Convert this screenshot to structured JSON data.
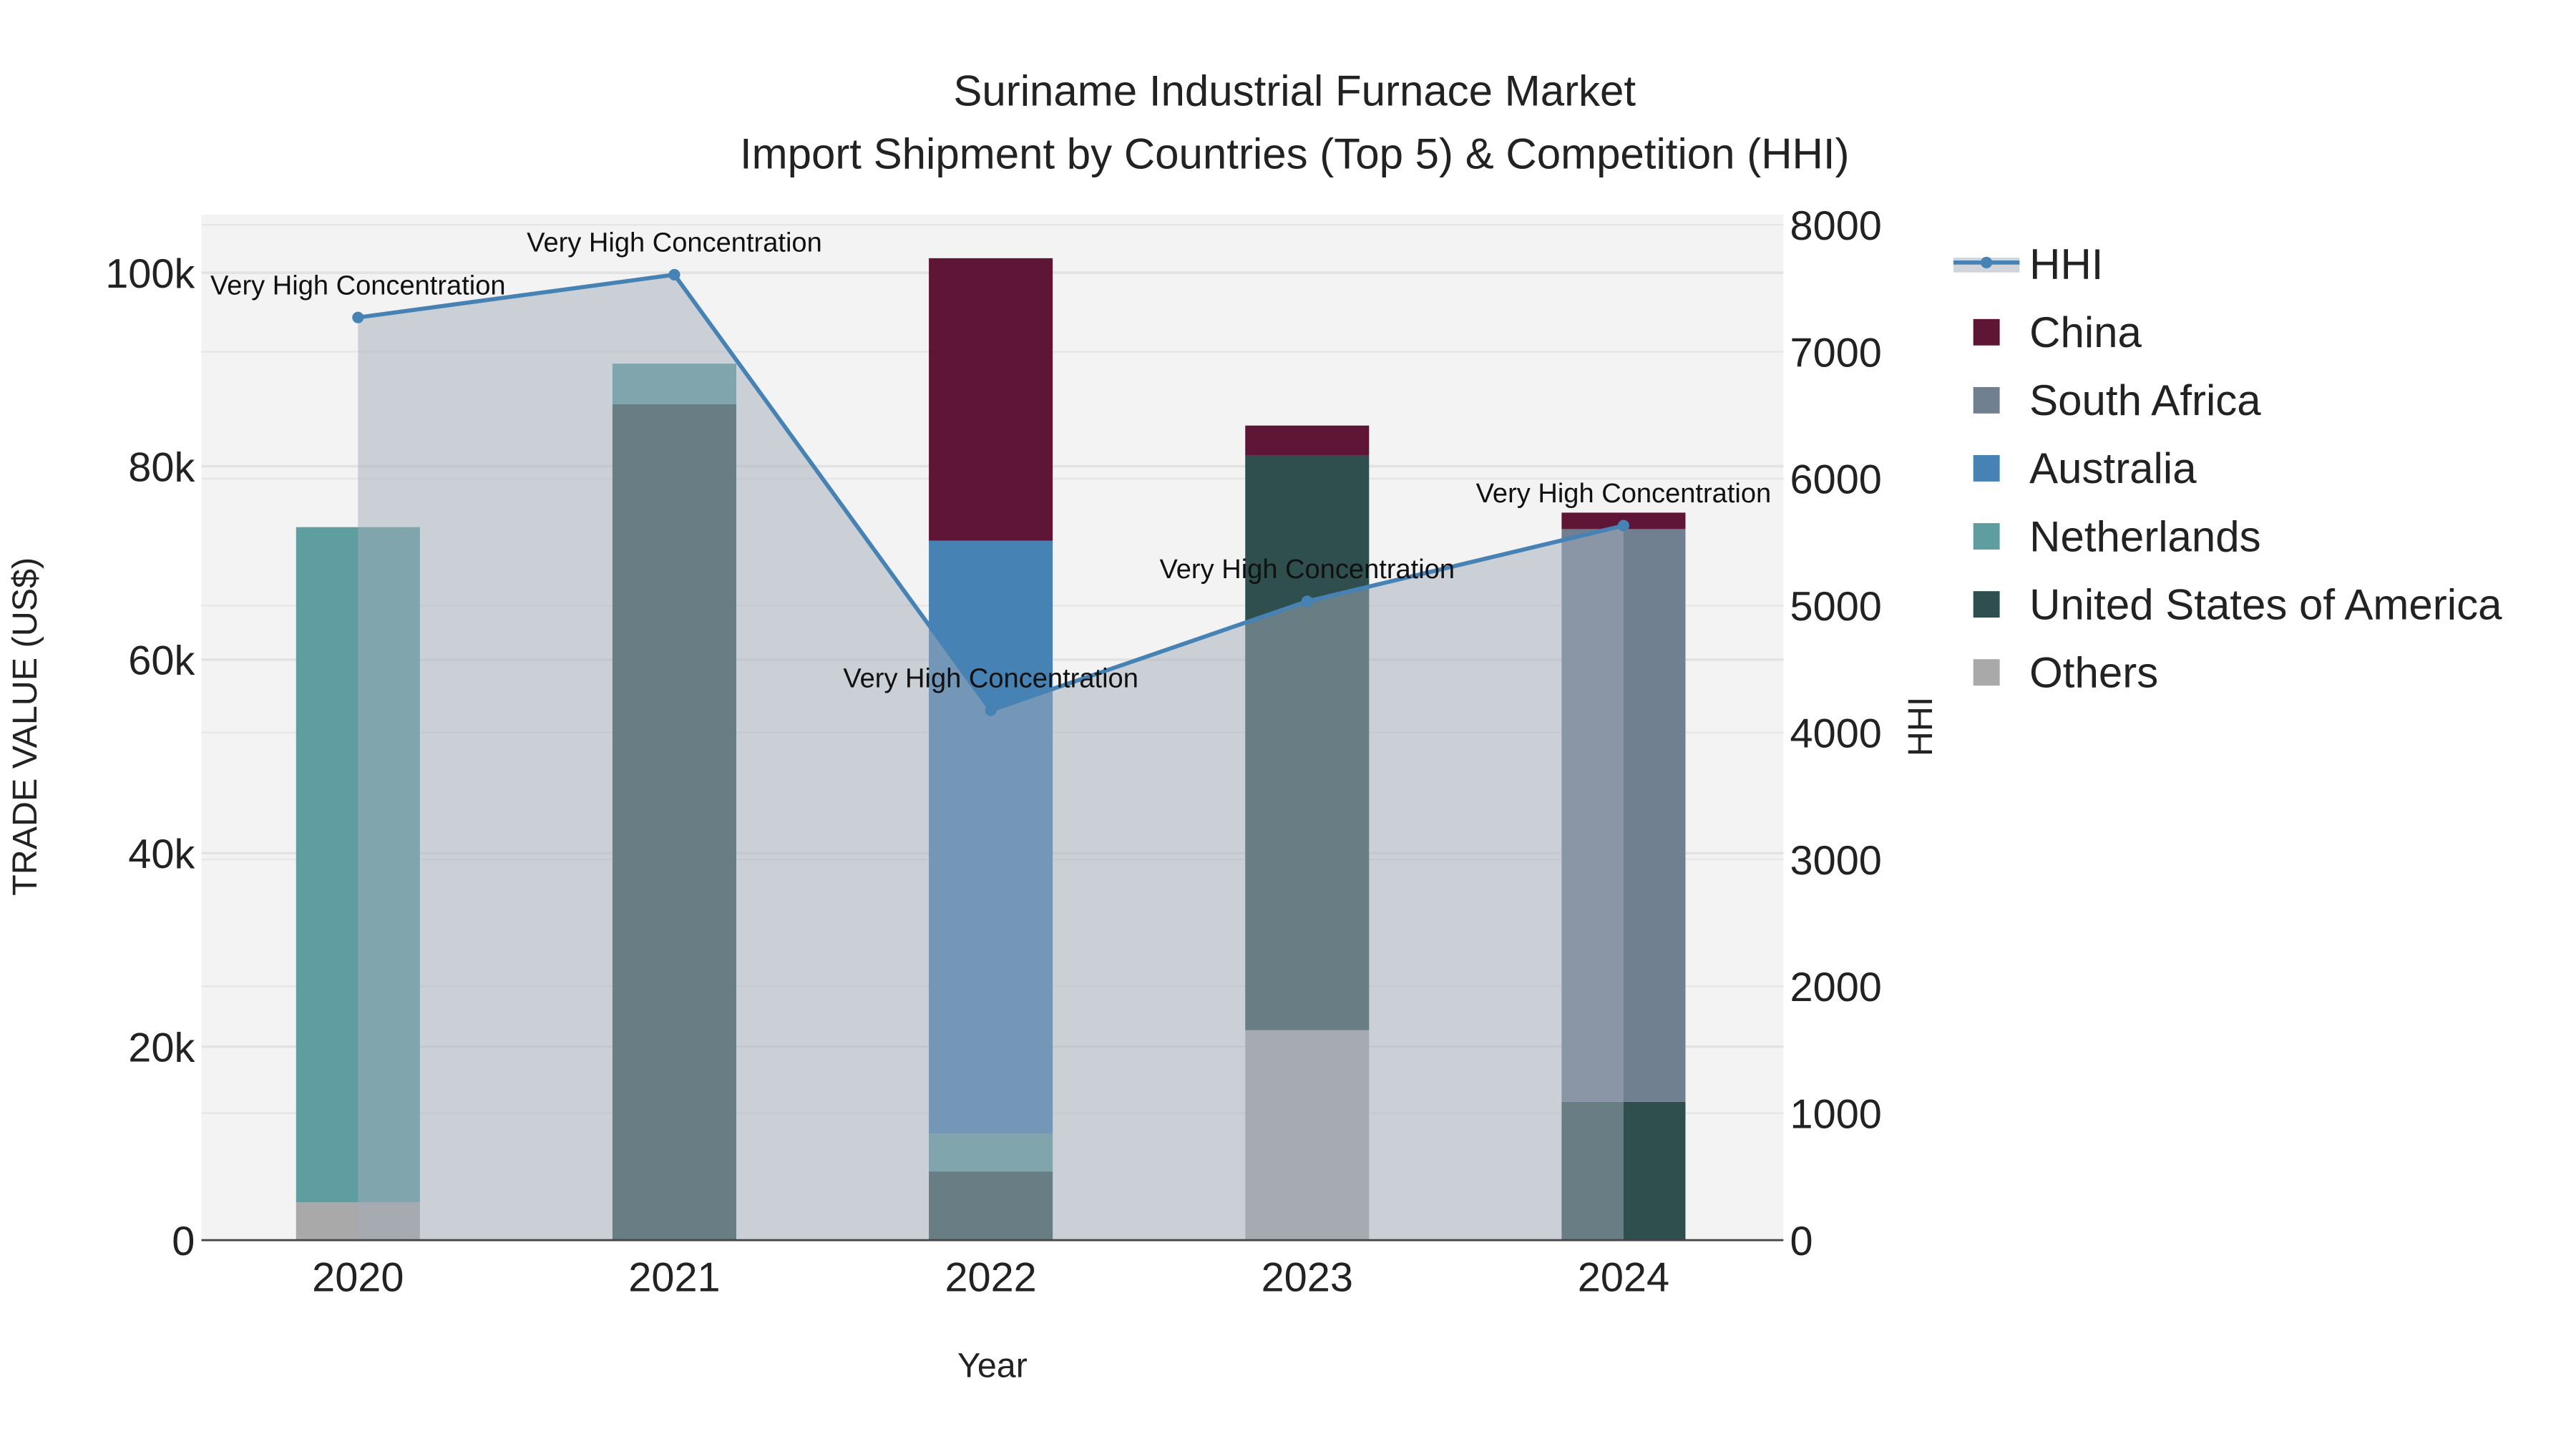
{
  "chart_data": {
    "type": "bar",
    "title": "Suriname Industrial Furnace Market",
    "subtitle": "Import Shipment by Countries (Top 5) & Competition (HHI)",
    "xlabel": "Year",
    "ylabel": "TRADE VALUE (US$)",
    "y2label": "HHI",
    "categories": [
      "2020",
      "2021",
      "2022",
      "2023",
      "2024"
    ],
    "ylim": [
      0,
      106000
    ],
    "y2lim": [
      0,
      8080
    ],
    "yticks": [
      0,
      20000,
      40000,
      60000,
      80000,
      100000
    ],
    "ytick_labels": [
      "0",
      "20k",
      "40k",
      "60k",
      "80k",
      "100k"
    ],
    "y2ticks": [
      0,
      1000,
      2000,
      3000,
      4000,
      5000,
      6000,
      7000,
      8000
    ],
    "y2tick_labels": [
      "0",
      "1000",
      "2000",
      "3000",
      "4000",
      "5000",
      "6000",
      "7000",
      "8000"
    ],
    "stack_order": [
      "Others",
      "United States of America",
      "Netherlands",
      "Australia",
      "South Africa",
      "China"
    ],
    "series": [
      {
        "name": "China",
        "color": "#5f1536",
        "values": [
          0,
          0,
          29200,
          3100,
          1700
        ]
      },
      {
        "name": "South Africa",
        "color": "#708090",
        "values": [
          0,
          0,
          0,
          0,
          59200
        ]
      },
      {
        "name": "Australia",
        "color": "#4682b4",
        "values": [
          0,
          0,
          61300,
          0,
          0
        ]
      },
      {
        "name": "Netherlands",
        "color": "#5f9ea0",
        "values": [
          69800,
          4200,
          3900,
          0,
          0
        ]
      },
      {
        "name": "United States of America",
        "color": "#2f4f4f",
        "values": [
          0,
          86400,
          7100,
          59400,
          14300
        ]
      },
      {
        "name": "Others",
        "color": "#a9a9a9",
        "values": [
          3900,
          0,
          0,
          21700,
          0
        ]
      }
    ],
    "hhi": {
      "name": "HHI",
      "color": "#4682b4",
      "values": [
        7270,
        7607,
        4175,
        5033,
        5630
      ],
      "annotations": [
        "Very High Concentration",
        "Very High Concentration",
        "Very High Concentration",
        "Very High Concentration",
        "Very High Concentration"
      ]
    },
    "legend_position": "right",
    "grid": true
  }
}
